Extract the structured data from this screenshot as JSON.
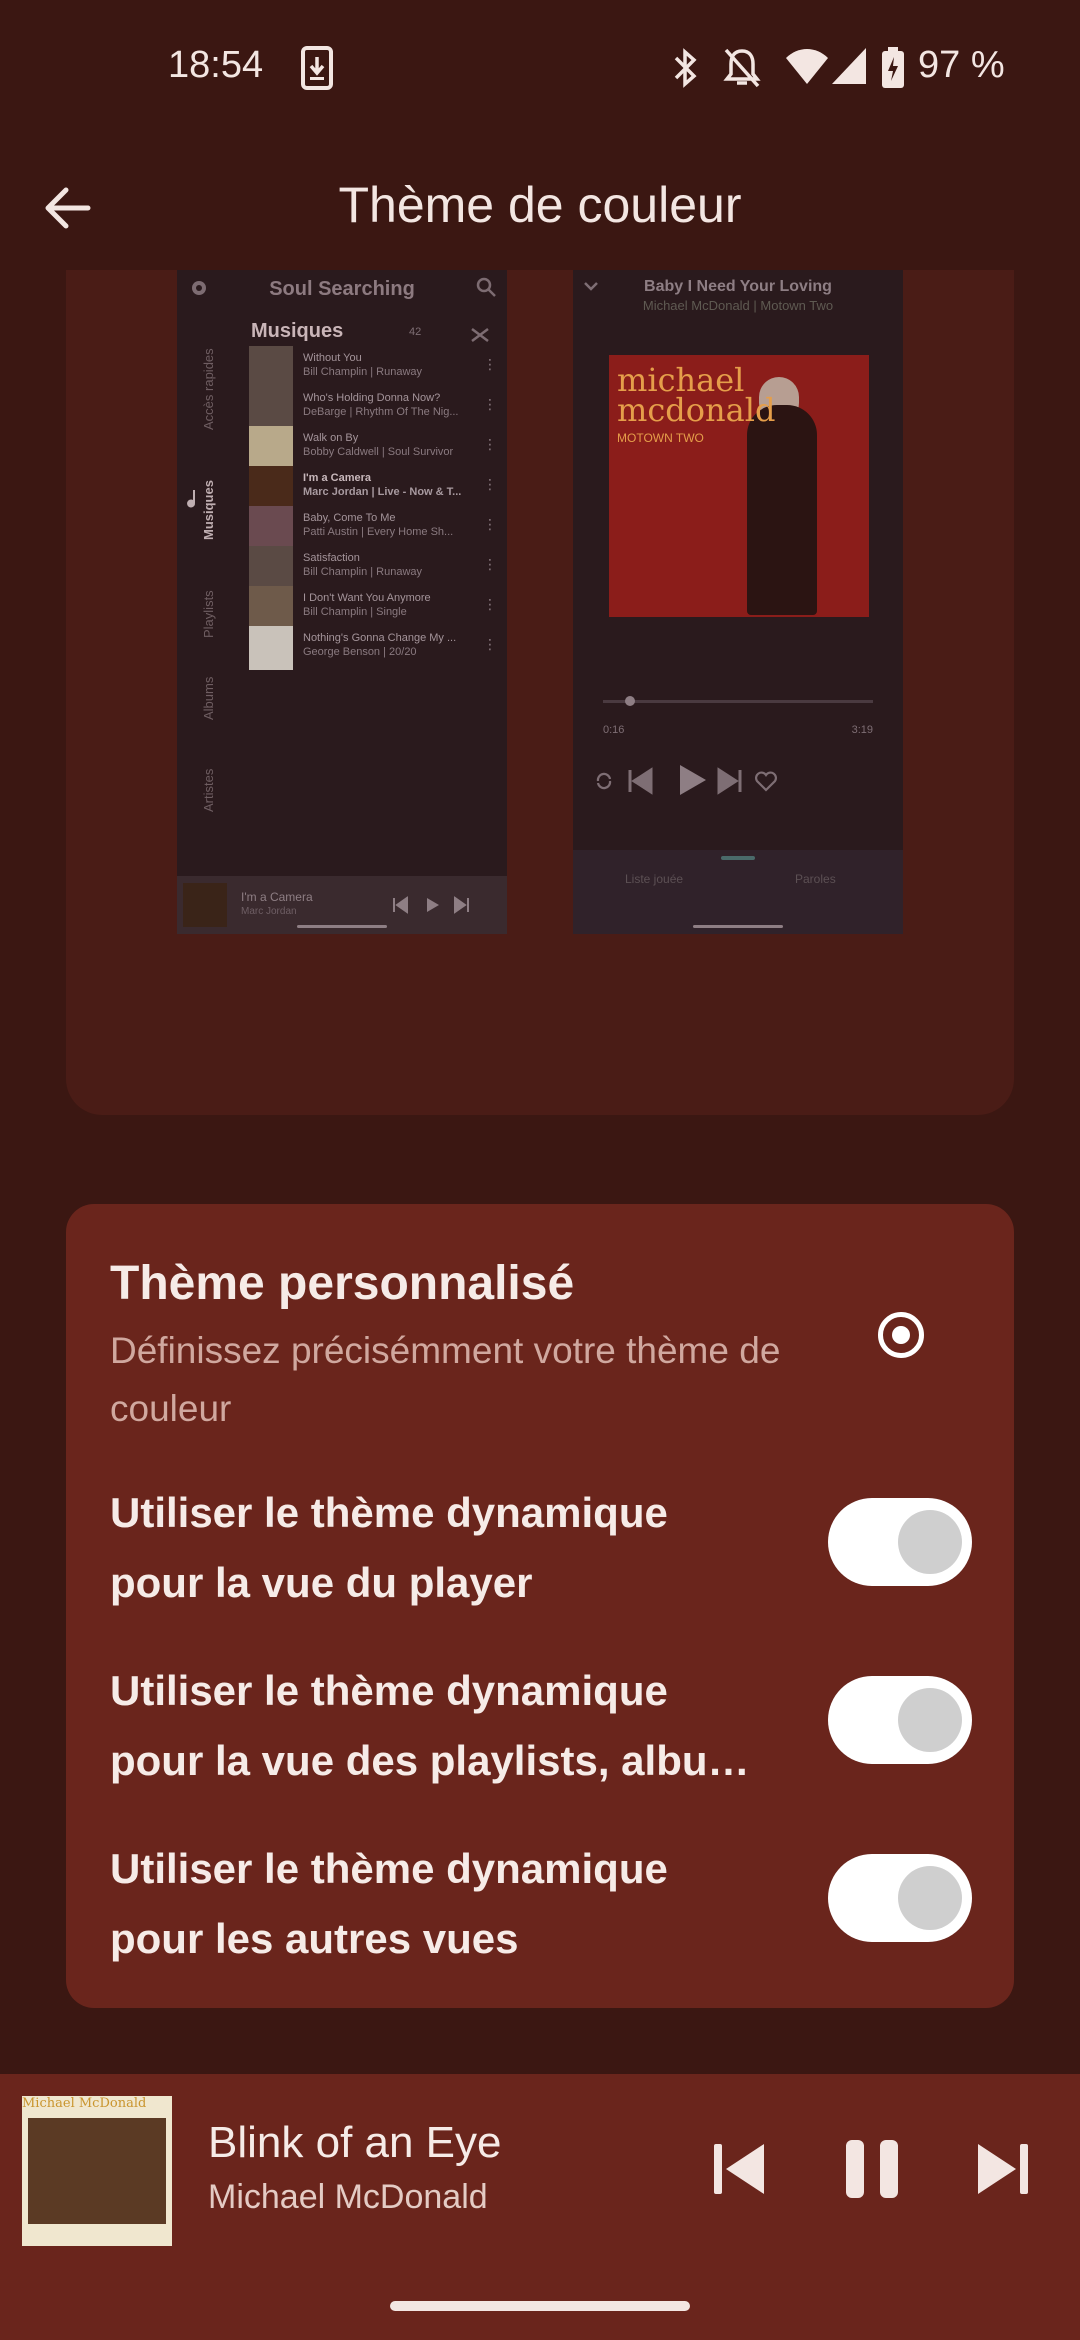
{
  "status_bar": {
    "time": "18:54",
    "battery": "97 %"
  },
  "app_bar": {
    "title": "Thème de couleur"
  },
  "preview": {
    "library": {
      "title": "Soul Searching",
      "heading": "Musiques",
      "count": "42",
      "tabs": [
        "Accès rapides",
        "Musiques",
        "Playlists",
        "Albums",
        "Artistes"
      ],
      "tracks": [
        {
          "title": "Without You",
          "subtitle": "Bill Champlin | Runaway"
        },
        {
          "title": "Who's Holding Donna Now?",
          "subtitle": "DeBarge | Rhythm Of The Nig..."
        },
        {
          "title": "Walk on By",
          "subtitle": "Bobby Caldwell | Soul Survivor"
        },
        {
          "title": "I'm a Camera",
          "subtitle": "Marc Jordan | Live - Now & T..."
        },
        {
          "title": "Baby, Come To Me",
          "subtitle": "Patti Austin | Every Home Sh..."
        },
        {
          "title": "Satisfaction",
          "subtitle": "Bill Champlin | Runaway"
        },
        {
          "title": "I Don't Want You Anymore",
          "subtitle": "Bill Champlin | Single"
        },
        {
          "title": "Nothing's Gonna Change My ...",
          "subtitle": "George Benson | 20/20"
        }
      ],
      "mini_player": {
        "title": "I'm a Camera",
        "artist": "Marc Jordan"
      }
    },
    "player": {
      "title": "Baby I Need Your Loving",
      "subtitle": "Michael McDonald | Motown Two",
      "art_text": "michael mcdonald",
      "art_sub": "MOTOWN TWO",
      "elapsed": "0:16",
      "duration": "3:19",
      "progress": 0.08,
      "tabs": [
        "Liste jouée",
        "Paroles"
      ]
    }
  },
  "settings": {
    "custom_theme_title": "Thème personnalisé",
    "custom_theme_subtitle": "Définissez précisémment votre thème de couleur",
    "options": [
      {
        "line1": "Utiliser le thème dynamique",
        "line2": "pour la vue du player"
      },
      {
        "line1": "Utiliser le thème dynamique",
        "line2": "pour la vue des playlists, albu…"
      },
      {
        "line1": "Utiliser le thème dynamique",
        "line2": "pour les autres vues"
      }
    ]
  },
  "now_playing": {
    "title": "Blink of an Eye",
    "artist": "Michael McDonald",
    "art_text": "Michael McDonald"
  },
  "colors": {
    "background": "#3b1712",
    "card": "#6a251c",
    "accent": "#ffffff"
  }
}
